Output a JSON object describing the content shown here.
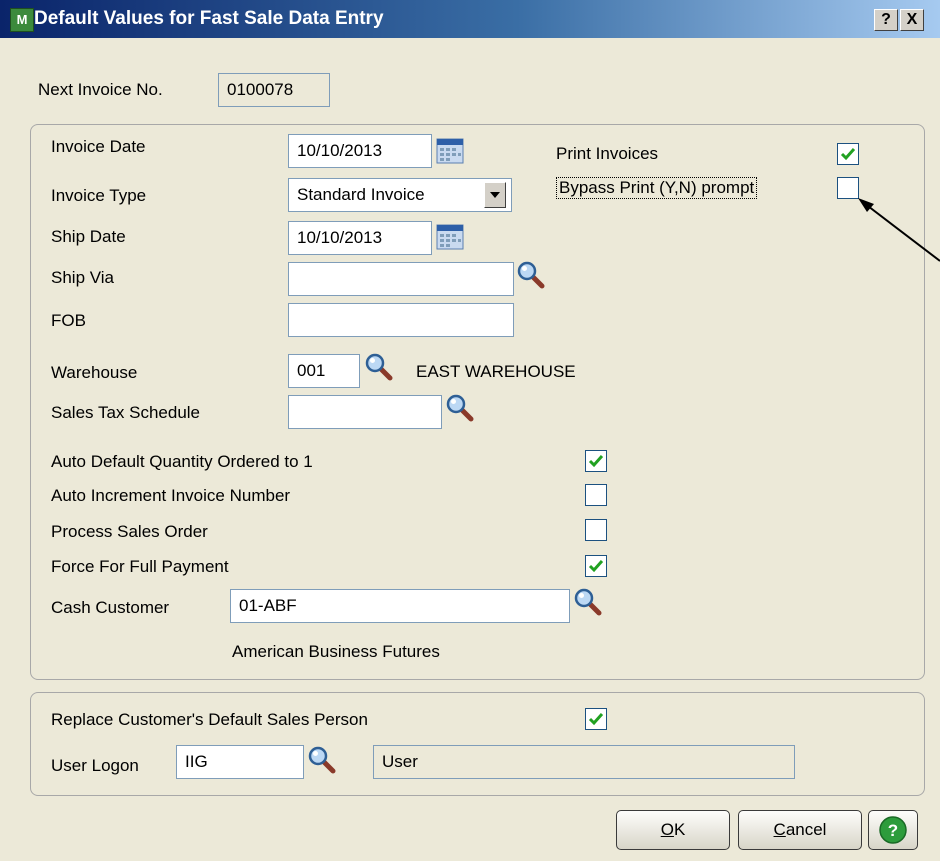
{
  "window": {
    "title": "Default Values for Fast Sale Data Entry",
    "help_glyph": "?",
    "close_glyph": "X",
    "app_icon": "mas-icon"
  },
  "next_invoice": {
    "label": "Next Invoice No.",
    "value": "0100078"
  },
  "main_group": {
    "invoice_date": {
      "label": "Invoice Date",
      "value": "10/10/2013"
    },
    "invoice_type": {
      "label": "Invoice Type",
      "value": "Standard Invoice"
    },
    "ship_date": {
      "label": "Ship Date",
      "value": "10/10/2013"
    },
    "ship_via": {
      "label": "Ship Via",
      "value": ""
    },
    "fob": {
      "label": "FOB",
      "value": ""
    },
    "warehouse": {
      "label": "Warehouse",
      "value": "001",
      "description": "EAST WAREHOUSE"
    },
    "sales_tax_schedule": {
      "label": "Sales Tax Schedule",
      "value": ""
    },
    "print_invoices": {
      "label": "Print Invoices",
      "checked": true
    },
    "bypass_print": {
      "label": "Bypass Print (Y,N) prompt",
      "checked": false
    },
    "auto_default_qty": {
      "label": "Auto Default Quantity Ordered to 1",
      "checked": true
    },
    "auto_increment": {
      "label": "Auto Increment Invoice Number",
      "checked": false
    },
    "process_sales_order": {
      "label": "Process Sales Order",
      "checked": false
    },
    "force_full_payment": {
      "label": "Force For Full Payment",
      "checked": true
    },
    "cash_customer": {
      "label": "Cash Customer",
      "value": "01-ABF",
      "name": "American Business Futures"
    }
  },
  "sales_group": {
    "replace_salesperson": {
      "label": "Replace Customer's Default Sales Person",
      "checked": true
    },
    "user_logon": {
      "label": "User Logon",
      "value": "IIG",
      "name": "User"
    }
  },
  "buttons": {
    "ok": {
      "mnemonic": "O",
      "rest": "K"
    },
    "cancel": {
      "mnemonic": "C",
      "rest": "ancel"
    },
    "help_glyph": "?"
  },
  "colors": {
    "title_start": "#0a246a",
    "title_end": "#a6caf0",
    "dialog_bg": "#ece9d8",
    "check_green": "#21a121",
    "help_green": "#2d9c3c"
  }
}
